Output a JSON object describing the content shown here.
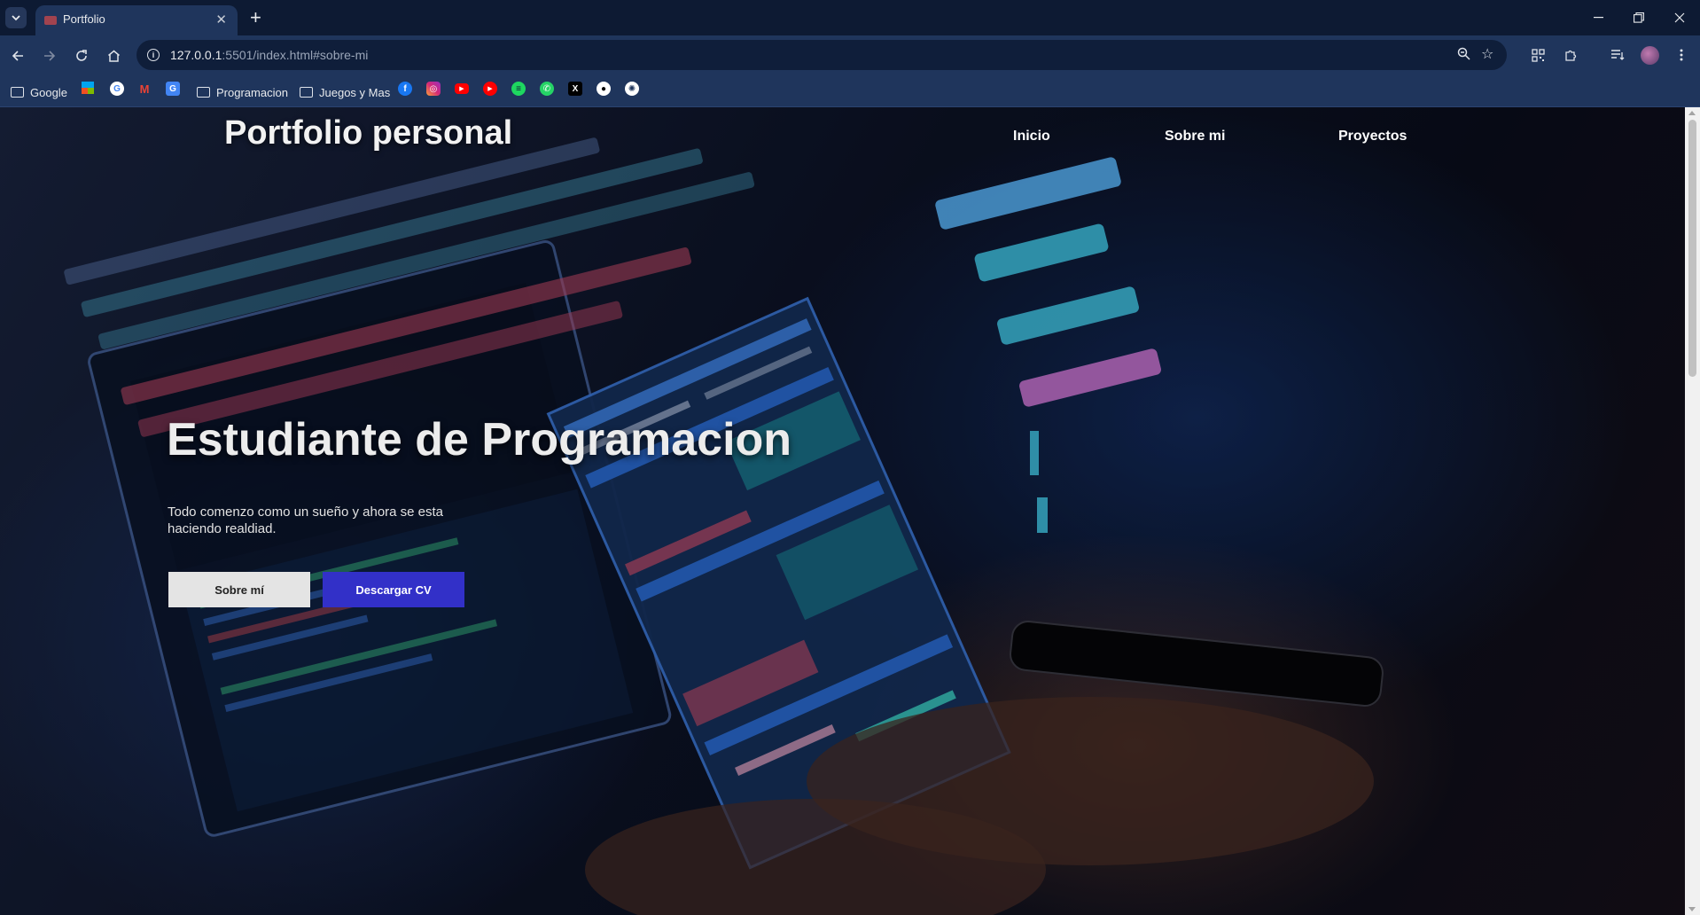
{
  "browser": {
    "tab": {
      "title": "Portfolio"
    },
    "address": {
      "host": "127.0.0.1",
      "path": ":5501/index.html#sobre-mi"
    },
    "bookmarks": [
      {
        "label": "Google",
        "icon": "folder-icon"
      },
      {
        "label": "Programacion",
        "icon": "folder-icon"
      },
      {
        "label": "Juegos y Mas",
        "icon": "folder-icon"
      }
    ],
    "bookmark_icons": [
      "microsoft-icon",
      "google-icon",
      "gmail-icon",
      "translate-icon",
      "facebook-icon",
      "instagram-icon",
      "youtube-icon",
      "youtube-music-icon",
      "spotify-icon",
      "whatsapp-icon",
      "x-icon",
      "github-icon",
      "chatgpt-icon"
    ]
  },
  "site": {
    "logo": "Portfolio personal",
    "nav": [
      {
        "label": "Inicio"
      },
      {
        "label": "Sobre mi"
      },
      {
        "label": "Proyectos"
      }
    ],
    "hero": {
      "title": "Estudiante de Programacion",
      "text": "Todo comenzo como un sueño y ahora se esta haciendo realdiad.",
      "buttons": [
        {
          "label": "Sobre mí"
        },
        {
          "label": "Descargar CV"
        }
      ]
    }
  },
  "colors": {
    "chrome_bg": "#0d1a33",
    "toolbar_bg": "#1f355c",
    "primary_button": "#3230c8",
    "light_button": "#e4e4e4"
  }
}
